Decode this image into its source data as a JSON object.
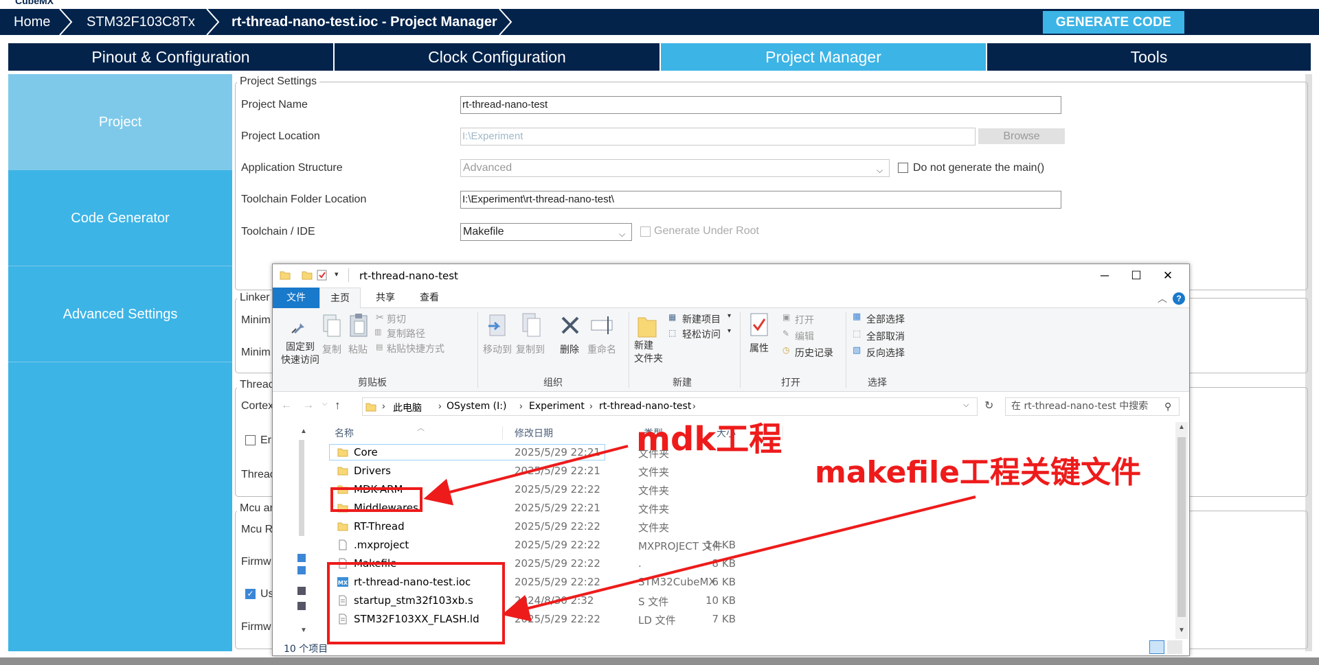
{
  "app": {
    "logo": "CubeMX"
  },
  "breadcrumbs": [
    "Home",
    "STM32F103C8Tx",
    "rt-thread-nano-test.ioc - Project Manager"
  ],
  "generate_button": "GENERATE CODE",
  "main_tabs": [
    "Pinout & Configuration",
    "Clock Configuration",
    "Project Manager",
    "Tools"
  ],
  "active_tab": "Project Manager",
  "left_nav": [
    "Project",
    "Code Generator",
    "Advanced Settings"
  ],
  "project_settings": {
    "group_title": "Project Settings",
    "project_name_label": "Project Name",
    "project_name": "rt-thread-nano-test",
    "project_location_label": "Project Location",
    "project_location": "I:\\Experiment",
    "browse_label": "Browse",
    "app_structure_label": "Application Structure",
    "app_structure": "Advanced",
    "no_main_label": "Do not generate the main()",
    "toolchain_folder_label": "Toolchain Folder Location",
    "toolchain_folder": "I:\\Experiment\\rt-thread-nano-test\\",
    "toolchain_ide_label": "Toolchain / IDE",
    "toolchain_ide": "Makefile",
    "gen_under_root_label": "Generate Under Root"
  },
  "partial_labels": {
    "linker": "Linker",
    "minim1": "Minim",
    "minim2": "Minim",
    "thread": "Threac",
    "cortex": "Cortex",
    "en": "Er",
    "thread2": "Threac",
    "mcu": "Mcu ar",
    "mcur": "Mcu R",
    "firmw1": "Firmw",
    "us": "Us",
    "firmw2": "Firmw"
  },
  "explorer": {
    "title": "rt-thread-nano-test",
    "window_buttons": [
      "─",
      "☐",
      "✕"
    ],
    "ribbon_tabs": [
      "文件",
      "主页",
      "共享",
      "查看"
    ],
    "ribbon": {
      "pin": "固定到\n快速访问",
      "copy": "复制",
      "paste": "粘贴",
      "cut": "剪切",
      "copy_path": "复制路径",
      "paste_shortcut": "粘贴快捷方式",
      "clipboard": "剪贴板",
      "move_to": "移动到",
      "copy_to": "复制到",
      "delete": "删除",
      "rename": "重命名",
      "organize": "组织",
      "new_folder": "新建\n文件夹",
      "new_item": "新建项目",
      "easy_access": "轻松访问",
      "new_group": "新建",
      "properties": "属性",
      "open": "打开",
      "edit": "编辑",
      "history": "历史记录",
      "open_group": "打开",
      "select_all": "全部选择",
      "select_none": "全部取消",
      "invert": "反向选择",
      "select_group": "选择"
    },
    "path": [
      "此电脑",
      "OSystem (I:)",
      "Experiment",
      "rt-thread-nano-test"
    ],
    "search_placeholder": "在 rt-thread-nano-test 中搜索",
    "columns": [
      "名称",
      "修改日期",
      "类型",
      "大小"
    ],
    "files": [
      {
        "name": "Core",
        "date": "2025/5/29 22:21",
        "type": "文件夹",
        "size": "",
        "icon": "folder"
      },
      {
        "name": "Drivers",
        "date": "2025/5/29 22:21",
        "type": "文件夹",
        "size": "",
        "icon": "folder"
      },
      {
        "name": "MDK-ARM",
        "date": "2025/5/29 22:22",
        "type": "文件夹",
        "size": "",
        "icon": "folder"
      },
      {
        "name": "Middlewares",
        "date": "2025/5/29 22:21",
        "type": "文件夹",
        "size": "",
        "icon": "folder"
      },
      {
        "name": "RT-Thread",
        "date": "2025/5/29 22:22",
        "type": "文件夹",
        "size": "",
        "icon": "folder"
      },
      {
        "name": ".mxproject",
        "date": "2025/5/29 22:22",
        "type": "MXPROJECT 文件",
        "size": "14 KB",
        "icon": "file"
      },
      {
        "name": "Makefile",
        "date": "2025/5/29 22:22",
        "type": ".",
        "size": "8 KB",
        "icon": "file"
      },
      {
        "name": "rt-thread-nano-test.ioc",
        "date": "2025/5/29 22:22",
        "type": "STM32CubeMX",
        "size": "6 KB",
        "icon": "mx"
      },
      {
        "name": "startup_stm32f103xb.s",
        "date": "2024/8/30 2:32",
        "type": "S 文件",
        "size": "10 KB",
        "icon": "file-lines"
      },
      {
        "name": "STM32F103XX_FLASH.ld",
        "date": "2025/5/29 22:22",
        "type": "LD 文件",
        "size": "7 KB",
        "icon": "file-lines"
      }
    ],
    "status": "10 个项目"
  },
  "annotations": {
    "mdk": "mdk工程",
    "makefile": "makefile工程关键文件",
    "color": "#ee1b1b"
  },
  "colors": {
    "navy": "#03234b",
    "accent": "#3cb4e6",
    "accent_light": "#7ec9ea"
  }
}
